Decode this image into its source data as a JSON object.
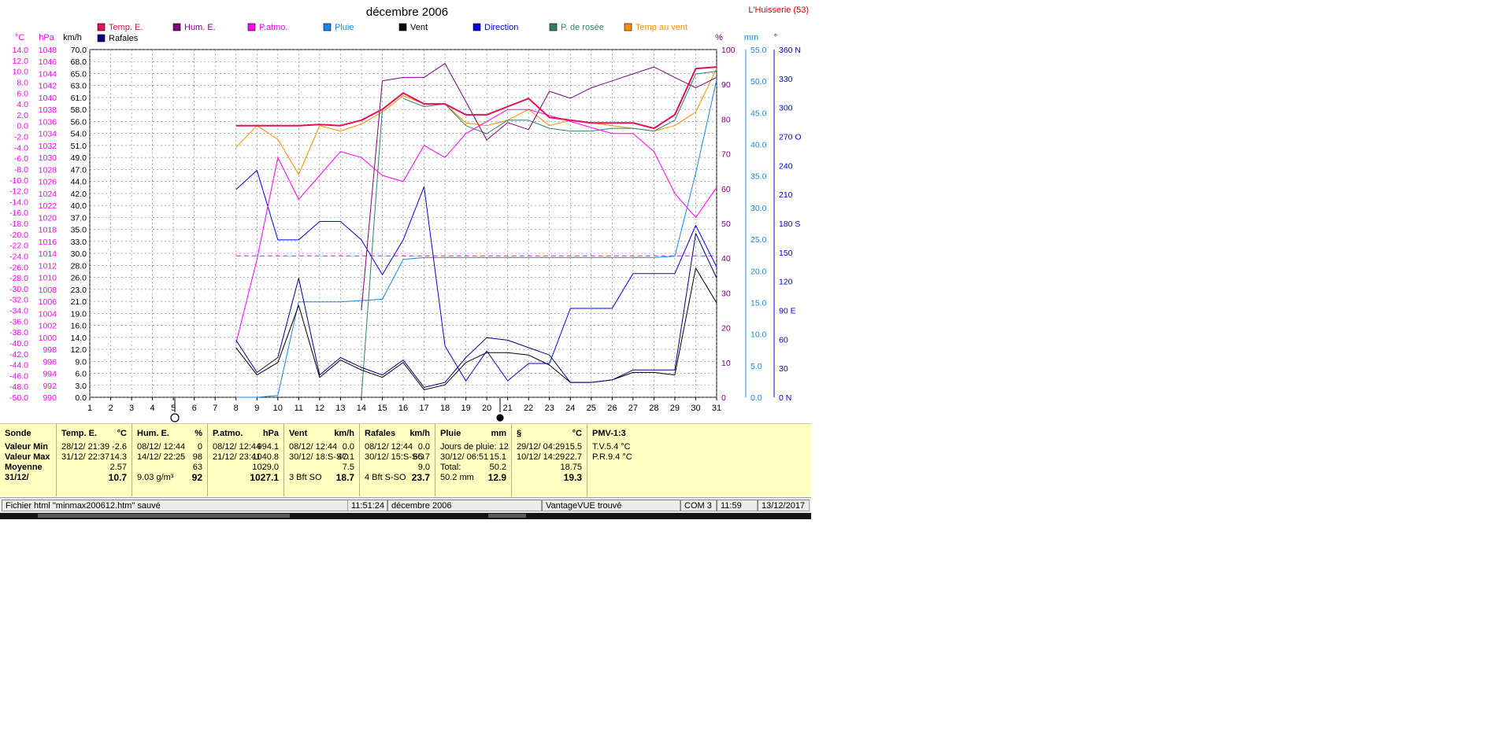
{
  "title": "décembre 2006",
  "station": "L'Huisserie (53)",
  "legend": [
    {
      "key": "temp",
      "label": "Temp. E.",
      "color": "#e0105a"
    },
    {
      "key": "hum",
      "label": "Hum. E.",
      "color": "#800080"
    },
    {
      "key": "patm",
      "label": "P.atmo.",
      "color": "#ff00ff"
    },
    {
      "key": "rain",
      "label": "Pluie",
      "color": "#1c86e8"
    },
    {
      "key": "wind",
      "label": "Vent",
      "color": "#000000"
    },
    {
      "key": "dir",
      "label": "Direction",
      "color": "#0000e0"
    },
    {
      "key": "dew",
      "label": "P. de rosée",
      "color": "#2f7f6f"
    },
    {
      "key": "chill",
      "label": "Temp au vent",
      "color": "#ff8c00"
    },
    {
      "key": "gust",
      "label": "Rafales",
      "color": "#000080"
    }
  ],
  "axis_units": {
    "temp": "°C",
    "patm": "hPa",
    "wind": "km/h",
    "hum": "%",
    "rain": "mm",
    "dir": "°"
  },
  "chart_data": {
    "type": "line",
    "x": [
      8,
      9,
      10,
      11,
      12,
      13,
      14,
      15,
      16,
      17,
      18,
      19,
      20,
      21,
      22,
      23,
      24,
      25,
      26,
      27,
      28,
      29,
      30,
      31
    ],
    "xlim": [
      1,
      31
    ],
    "x_ticks": [
      "1",
      "2",
      "3",
      "4",
      "5",
      "6",
      "7",
      "8",
      "9",
      "10",
      "11",
      "12",
      "13",
      "14",
      "15",
      "16",
      "17",
      "18",
      "19",
      "20",
      "21",
      "22",
      "23",
      "24",
      "25",
      "26",
      "27",
      "28",
      "29",
      "30",
      "31"
    ],
    "axes": {
      "temp": {
        "min": -50,
        "max": 14,
        "ticks": [
          "14.0",
          "12.0",
          "10.0",
          "8.0",
          "6.0",
          "4.0",
          "2.0",
          "0.0",
          "-2.0",
          "-4.0",
          "-6.0",
          "-8.0",
          "-10.0",
          "-12.0",
          "-14.0",
          "-16.0",
          "-18.0",
          "-20.0",
          "-22.0",
          "-24.0",
          "-26.0",
          "-28.0",
          "-30.0",
          "-32.0",
          "-34.0",
          "-36.0",
          "-38.0",
          "-40.0",
          "-42.0",
          "-44.0",
          "-46.0",
          "-48.0",
          "-50.0"
        ]
      },
      "patm": {
        "min": 990,
        "max": 1048,
        "ticks": [
          "1048",
          "1046",
          "1044",
          "1042",
          "1040",
          "1038",
          "1036",
          "1034",
          "1032",
          "1030",
          "1028",
          "1026",
          "1024",
          "1022",
          "1020",
          "1018",
          "1016",
          "1014",
          "1012",
          "1010",
          "1008",
          "1006",
          "1004",
          "1002",
          "1000",
          "998",
          "996",
          "994",
          "992",
          "990"
        ]
      },
      "wind": {
        "min": 0,
        "max": 70,
        "ticks": [
          "70.0",
          "68.0",
          "65.0",
          "63.0",
          "61.0",
          "58.0",
          "56.0",
          "54.0",
          "51.0",
          "49.0",
          "47.0",
          "44.0",
          "42.0",
          "40.0",
          "37.0",
          "35.0",
          "33.0",
          "30.0",
          "28.0",
          "26.0",
          "23.0",
          "21.0",
          "19.0",
          "16.0",
          "14.0",
          "12.0",
          "9.0",
          "6.0",
          "3.0",
          "0.0"
        ]
      },
      "hum": {
        "min": 0,
        "max": 100,
        "ticks": [
          "100",
          "90",
          "80",
          "70",
          "60",
          "50",
          "40",
          "30",
          "20",
          "10",
          "0"
        ]
      },
      "rain": {
        "min": 0,
        "max": 55,
        "ticks": [
          "55.0",
          "50.0",
          "45.0",
          "40.0",
          "35.0",
          "30.0",
          "25.0",
          "20.0",
          "15.0",
          "10.0",
          "5.0",
          "0.0"
        ]
      },
      "dir": {
        "min": 0,
        "max": 360,
        "ticks": [
          "360 N",
          "330",
          "300",
          "270 O",
          "240",
          "210",
          "180 S",
          "150",
          "120",
          "90  E",
          "60",
          "30",
          "0   N"
        ]
      }
    },
    "series": [
      {
        "key": "temp",
        "name": "Temp. E.",
        "axis": "temp",
        "width": 2,
        "values": [
          0,
          0,
          0,
          0,
          0.2,
          0,
          1,
          3,
          6,
          4,
          4,
          2,
          2,
          3.5,
          5,
          1.5,
          1,
          0.5,
          0.5,
          0.5,
          -0.5,
          2,
          10.5,
          10.8
        ]
      },
      {
        "key": "hum",
        "name": "Hum. E.",
        "axis": "hum",
        "width": 1,
        "values": [
          null,
          null,
          null,
          null,
          null,
          0,
          null,
          91,
          92,
          92,
          96,
          85,
          74,
          79,
          77,
          88,
          86,
          89,
          91,
          93,
          95,
          92,
          89,
          92
        ]
      },
      {
        "key": "patm",
        "name": "P.atmo.",
        "axis": "patm",
        "width": 1,
        "values": [
          999,
          1013,
          1030,
          1023,
          1027,
          1031,
          1030,
          1027,
          1026,
          1032,
          1030,
          1034,
          1036,
          1038,
          1038,
          1037,
          1036,
          1035,
          1034,
          1034,
          1031,
          1024,
          1020,
          1025
        ]
      },
      {
        "key": "rain",
        "name": "Pluie",
        "axis": "rain",
        "width": 1,
        "values": [
          0,
          0,
          0.3,
          15.1,
          15.1,
          15.1,
          15.3,
          15.5,
          21.8,
          22.1,
          22.1,
          22.1,
          22.1,
          22.1,
          22.1,
          22.1,
          22.1,
          22.1,
          22.1,
          22.1,
          22.1,
          22.3,
          35.5,
          50.2
        ]
      },
      {
        "key": "wind",
        "name": "Vent",
        "axis": "wind",
        "width": 1,
        "values": [
          10,
          4.5,
          7,
          18.5,
          4,
          7.5,
          5.5,
          4,
          7,
          1.5,
          2.5,
          7,
          9,
          9,
          8.5,
          6.5,
          3,
          3,
          3.5,
          5,
          5,
          4.5,
          26,
          19
        ]
      },
      {
        "key": "dir",
        "name": "Direction",
        "axis": "dir",
        "width": 1,
        "values": [
          0,
          0,
          0,
          0,
          0,
          0,
          0,
          0,
          0,
          0,
          0,
          0,
          0,
          0,
          0,
          0,
          0,
          0,
          0,
          0,
          0,
          0,
          0,
          0
        ]
      },
      {
        "key": "dir2",
        "name": "Direction",
        "axis": "dir",
        "width": 1,
        "values": [
          215,
          235,
          163,
          163,
          182,
          182,
          163,
          127,
          163,
          218,
          53,
          17,
          48,
          17,
          35,
          35,
          92,
          92,
          92,
          128,
          128,
          128,
          178,
          135
        ]
      },
      {
        "key": "dew",
        "name": "P. de rosée",
        "axis": "temp",
        "width": 1,
        "values": [
          null,
          null,
          null,
          null,
          null,
          null,
          null,
          null,
          5,
          3.5,
          4,
          0,
          -1.5,
          1,
          1,
          -0.5,
          -1,
          -1,
          -0.5,
          -0.5,
          -1,
          1,
          9.5,
          10
        ]
      },
      {
        "key": "dewrise",
        "name": "P. de rosée",
        "axis": "temp",
        "width": 1,
        "values": [
          null,
          null,
          null,
          null,
          null,
          null,
          -50,
          3,
          null,
          null,
          null,
          null,
          null,
          null,
          null,
          null,
          null,
          null,
          null,
          null,
          null,
          null,
          null,
          null
        ]
      },
      {
        "key": "chill",
        "name": "Temp au vent",
        "axis": "temp",
        "width": 1,
        "values": [
          -4,
          0,
          -2.5,
          -9,
          0,
          -1,
          0.3,
          2.5,
          5.5,
          4,
          4,
          0.5,
          0,
          1,
          3,
          0,
          1,
          0.5,
          0,
          -0.5,
          -1,
          0,
          2.5,
          10.5
        ]
      },
      {
        "key": "gust",
        "name": "Rafales",
        "axis": "wind",
        "width": 1,
        "values": [
          11.5,
          5,
          8,
          24,
          4.5,
          8,
          6,
          4.5,
          7.5,
          2,
          3,
          8,
          12,
          11.5,
          10,
          8.5,
          3,
          3,
          3.5,
          5.5,
          5.5,
          5.5,
          33,
          24
        ]
      },
      {
        "key": "hum2",
        "name": "Hum. E.",
        "axis": "hum",
        "width": 1,
        "values": [
          null,
          null,
          null,
          null,
          null,
          null,
          25,
          91,
          null,
          null,
          null,
          null,
          null,
          null,
          null,
          null,
          null,
          null,
          null,
          null,
          null,
          null,
          null,
          null
        ]
      },
      {
        "key": "patmavg",
        "name": "P.atmo.",
        "axis": "patm",
        "width": 1,
        "dash": "6,4",
        "values": [
          1013.6,
          1013.6,
          1013.6,
          1013.6,
          1013.6,
          1013.6,
          1013.6,
          1013.6,
          1013.6,
          1013.6,
          1013.6,
          1013.6,
          1013.6,
          1013.6,
          1013.6,
          1013.6,
          1013.6,
          1013.6,
          1013.6,
          1013.6,
          1013.6,
          1013.6,
          1013.6,
          1013.6
        ]
      }
    ]
  },
  "stats": {
    "columns": [
      {
        "key": "sonde",
        "header": "Sonde",
        "unit": "",
        "rows": [
          {
            "l": "Valeur Min",
            "r": ""
          },
          {
            "l": "Valeur Max",
            "r": ""
          },
          {
            "l": "Moyenne",
            "r": ""
          },
          {
            "l": "31/12/",
            "r": ""
          }
        ]
      },
      {
        "key": "temp",
        "header": "Temp. E.",
        "unit": "°C",
        "rows": [
          {
            "l": "28/12/  21:39",
            "r": "-2.6"
          },
          {
            "l": "31/12/  22:37",
            "r": "14.3"
          },
          {
            "l": "",
            "r": "2.57"
          },
          {
            "l": "",
            "r": "10.7"
          }
        ]
      },
      {
        "key": "hum",
        "header": "Hum. E.",
        "unit": "%",
        "rows": [
          {
            "l": "08/12/  12:44",
            "r": "0"
          },
          {
            "l": "14/12/  22:25",
            "r": "98"
          },
          {
            "l": "",
            "r": "63"
          },
          {
            "l": "9.03 g/m³",
            "r": "92"
          }
        ]
      },
      {
        "key": "patm",
        "header": "P.atmo.",
        "unit": "hPa",
        "rows": [
          {
            "l": "08/12/  12:44",
            "r": "994.1"
          },
          {
            "l": "21/12/  23:41",
            "r": "1040.8"
          },
          {
            "l": "",
            "r": "1029.0"
          },
          {
            "l": "",
            "r": "1027.1"
          }
        ]
      },
      {
        "key": "vent",
        "header": "Vent",
        "unit": "km/h",
        "rows": [
          {
            "l": "08/12/  12:44",
            "r": "0.0"
          },
          {
            "l": "30/12/  18:S-SO",
            "r": "47.1"
          },
          {
            "l": "",
            "r": "7.5"
          },
          {
            "l": "3 Bft SO",
            "r": "18.7"
          }
        ]
      },
      {
        "key": "raf",
        "header": "Rafales",
        "unit": "km/h",
        "rows": [
          {
            "l": "08/12/  12:44",
            "r": "0.0"
          },
          {
            "l": "30/12/  15:S-SO",
            "r": "65.7"
          },
          {
            "l": "",
            "r": "9.0"
          },
          {
            "l": "4 Bft S-SO",
            "r": "23.7"
          }
        ]
      },
      {
        "key": "pluie",
        "header": "Pluie",
        "unit": "mm",
        "rows": [
          {
            "l": "Jours de pluie: 12",
            "r": ""
          },
          {
            "l": "30/12/  06:51",
            "r": "15.1"
          },
          {
            "l": "Total:",
            "r": "50.2"
          },
          {
            "l": "50.2 mm",
            "r": "12.9"
          }
        ]
      },
      {
        "key": "s",
        "header": "§",
        "unit": "°C",
        "rows": [
          {
            "l": "29/12/  04:29",
            "r": "15.5"
          },
          {
            "l": "10/12/  14:29",
            "r": "22.7"
          },
          {
            "l": "",
            "r": "18.75"
          },
          {
            "l": "",
            "r": "19.3"
          }
        ]
      },
      {
        "key": "pmv",
        "header": "PMV-1:3",
        "unit": "",
        "rows": [
          {
            "l": "T.V.5.4 °C",
            "r": ""
          },
          {
            "l": "P.R.9.4 °C",
            "r": ""
          },
          {
            "l": "",
            "r": ""
          },
          {
            "l": "",
            "r": ""
          }
        ]
      }
    ]
  },
  "statusbar": {
    "file": "Fichier html  \"minmax200612.htm\"  sauvé",
    "time": "11:51:24",
    "month": "décembre 2006",
    "device": "VantageVUE trouvé",
    "port": "COM 3",
    "clock": "11:59",
    "date": "13/12/2017"
  },
  "tray_time": "11:59"
}
